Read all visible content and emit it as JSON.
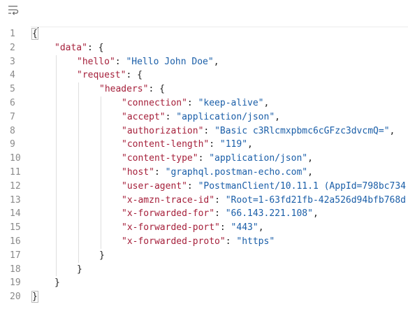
{
  "toolbar": {
    "wrap_icon": "wrap-lines-icon"
  },
  "line_numbers": [
    "1",
    "2",
    "3",
    "4",
    "5",
    "6",
    "7",
    "8",
    "9",
    "10",
    "11",
    "12",
    "13",
    "14",
    "15",
    "16",
    "17",
    "18",
    "19",
    "20"
  ],
  "json_lines": [
    {
      "indent": 0,
      "parts": [
        {
          "t": "{",
          "c": "punc"
        }
      ]
    },
    {
      "indent": 1,
      "parts": [
        {
          "t": "\"data\"",
          "c": "key"
        },
        {
          "t": ": {",
          "c": "punc"
        }
      ]
    },
    {
      "indent": 2,
      "parts": [
        {
          "t": "\"hello\"",
          "c": "key"
        },
        {
          "t": ": ",
          "c": "punc"
        },
        {
          "t": "\"Hello John Doe\"",
          "c": "str"
        },
        {
          "t": ",",
          "c": "punc"
        }
      ]
    },
    {
      "indent": 2,
      "parts": [
        {
          "t": "\"request\"",
          "c": "key"
        },
        {
          "t": ": {",
          "c": "punc"
        }
      ]
    },
    {
      "indent": 3,
      "parts": [
        {
          "t": "\"headers\"",
          "c": "key"
        },
        {
          "t": ": {",
          "c": "punc"
        }
      ]
    },
    {
      "indent": 4,
      "parts": [
        {
          "t": "\"connection\"",
          "c": "key"
        },
        {
          "t": ": ",
          "c": "punc"
        },
        {
          "t": "\"keep-alive\"",
          "c": "str"
        },
        {
          "t": ",",
          "c": "punc"
        }
      ]
    },
    {
      "indent": 4,
      "parts": [
        {
          "t": "\"accept\"",
          "c": "key"
        },
        {
          "t": ": ",
          "c": "punc"
        },
        {
          "t": "\"application/json\"",
          "c": "str"
        },
        {
          "t": ",",
          "c": "punc"
        }
      ]
    },
    {
      "indent": 4,
      "parts": [
        {
          "t": "\"authorization\"",
          "c": "key"
        },
        {
          "t": ": ",
          "c": "punc"
        },
        {
          "t": "\"Basic c3Rlcmxpbmc6cGFzc3dvcmQ=\"",
          "c": "str"
        },
        {
          "t": ",",
          "c": "punc"
        }
      ]
    },
    {
      "indent": 4,
      "parts": [
        {
          "t": "\"content-length\"",
          "c": "key"
        },
        {
          "t": ": ",
          "c": "punc"
        },
        {
          "t": "\"119\"",
          "c": "str"
        },
        {
          "t": ",",
          "c": "punc"
        }
      ]
    },
    {
      "indent": 4,
      "parts": [
        {
          "t": "\"content-type\"",
          "c": "key"
        },
        {
          "t": ": ",
          "c": "punc"
        },
        {
          "t": "\"application/json\"",
          "c": "str"
        },
        {
          "t": ",",
          "c": "punc"
        }
      ]
    },
    {
      "indent": 4,
      "parts": [
        {
          "t": "\"host\"",
          "c": "key"
        },
        {
          "t": ": ",
          "c": "punc"
        },
        {
          "t": "\"graphql.postman-echo.com\"",
          "c": "str"
        },
        {
          "t": ",",
          "c": "punc"
        }
      ]
    },
    {
      "indent": 4,
      "parts": [
        {
          "t": "\"user-agent\"",
          "c": "key"
        },
        {
          "t": ": ",
          "c": "punc"
        },
        {
          "t": "\"PostmanClient/10.11.1 (AppId=798bc734",
          "c": "str"
        }
      ]
    },
    {
      "indent": 4,
      "parts": [
        {
          "t": "\"x-amzn-trace-id\"",
          "c": "key"
        },
        {
          "t": ": ",
          "c": "punc"
        },
        {
          "t": "\"Root=1-63fd21fb-42a526d94bfb768d",
          "c": "str"
        }
      ]
    },
    {
      "indent": 4,
      "parts": [
        {
          "t": "\"x-forwarded-for\"",
          "c": "key"
        },
        {
          "t": ": ",
          "c": "punc"
        },
        {
          "t": "\"66.143.221.108\"",
          "c": "str"
        },
        {
          "t": ",",
          "c": "punc"
        }
      ]
    },
    {
      "indent": 4,
      "parts": [
        {
          "t": "\"x-forwarded-port\"",
          "c": "key"
        },
        {
          "t": ": ",
          "c": "punc"
        },
        {
          "t": "\"443\"",
          "c": "str"
        },
        {
          "t": ",",
          "c": "punc"
        }
      ]
    },
    {
      "indent": 4,
      "parts": [
        {
          "t": "\"x-forwarded-proto\"",
          "c": "key"
        },
        {
          "t": ": ",
          "c": "punc"
        },
        {
          "t": "\"https\"",
          "c": "str"
        }
      ]
    },
    {
      "indent": 3,
      "parts": [
        {
          "t": "}",
          "c": "punc"
        }
      ]
    },
    {
      "indent": 2,
      "parts": [
        {
          "t": "}",
          "c": "punc"
        }
      ]
    },
    {
      "indent": 1,
      "parts": [
        {
          "t": "}",
          "c": "punc"
        }
      ]
    },
    {
      "indent": 0,
      "parts": [
        {
          "t": "}",
          "c": "punc"
        }
      ]
    }
  ],
  "colors": {
    "key": "#a51f3a",
    "string": "#1a5ea8",
    "punctuation": "#212121",
    "line_number": "#8a8a8a",
    "indent_guide": "#dedede"
  }
}
